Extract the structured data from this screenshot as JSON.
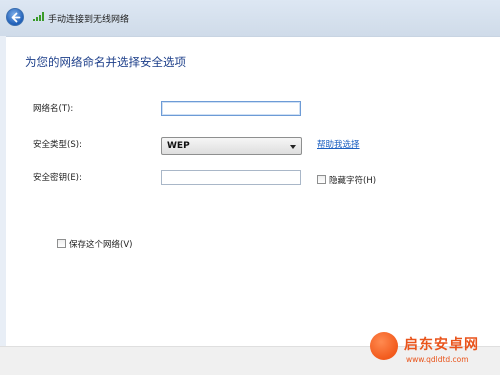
{
  "window": {
    "title": "手动连接到无线网络"
  },
  "main": {
    "heading": "为您的网络命名并选择安全选项",
    "network_name": {
      "label": "网络名(T):",
      "value": ""
    },
    "security_type": {
      "label": "安全类型(S):",
      "value": "WEP",
      "help_link": "帮助我选择"
    },
    "security_key": {
      "label": "安全密钥(E):",
      "value": ""
    },
    "hide_chars": {
      "label": "隐藏字符(H)",
      "checked": false
    },
    "save_network": {
      "label": "保存这个网络(V)",
      "checked": false
    }
  },
  "watermark": {
    "title": "启东安卓网",
    "url": "www.qdldtd.com"
  },
  "colors": {
    "heading": "#1d3f8a",
    "link": "#1b5fc1",
    "watermark": "#e9541b"
  }
}
